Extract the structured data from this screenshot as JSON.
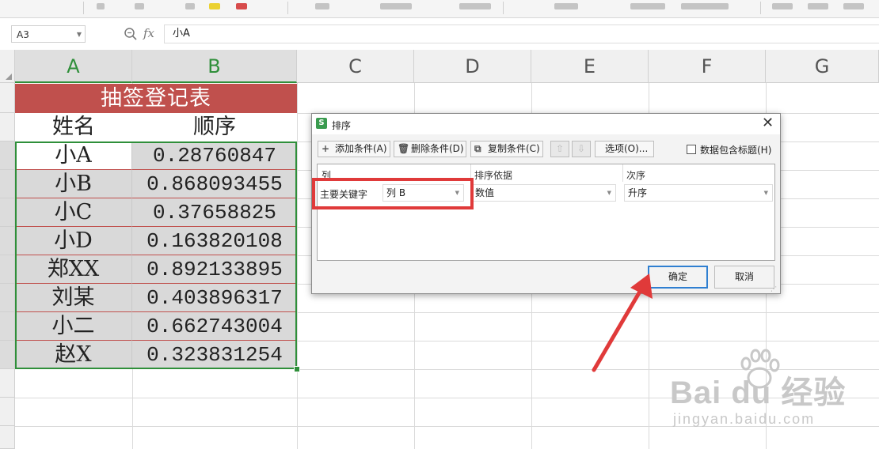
{
  "formula_bar": {
    "name_box": "A3",
    "fx_label": "fx",
    "content": "小A"
  },
  "columns": [
    "A",
    "B",
    "C",
    "D",
    "E",
    "F",
    "G"
  ],
  "table": {
    "title": "抽签登记表",
    "headers": [
      "姓名",
      "顺序"
    ],
    "rows": [
      {
        "name": "小A",
        "value": "0.28760847"
      },
      {
        "name": "小B",
        "value": "0.868093455"
      },
      {
        "name": "小C",
        "value": "0.37658825"
      },
      {
        "name": "小D",
        "value": "0.163820108"
      },
      {
        "name": "郑XX",
        "value": "0.892133895"
      },
      {
        "name": "刘某",
        "value": "0.403896317"
      },
      {
        "name": "小二",
        "value": "0.662743004"
      },
      {
        "name": "赵X",
        "value": "0.323831254"
      }
    ]
  },
  "sort_dialog": {
    "title": "排序",
    "toolbar": {
      "add_condition": "添加条件(A)",
      "delete_condition": "删除条件(D)",
      "copy_condition": "复制条件(C)",
      "options": "选项(O)...",
      "has_header_checkbox": "数据包含标题(H)",
      "has_header_checked": false
    },
    "headers": {
      "column": "列",
      "sort_on": "排序依据",
      "order": "次序"
    },
    "condition": {
      "label": "主要关键字",
      "column": "列 B",
      "sort_on": "数值",
      "order": "升序"
    },
    "ok_label": "确定",
    "cancel_label": "取消"
  },
  "watermark": {
    "main": "Bai du 经验",
    "sub": "jingyan.baidu.com"
  },
  "colors": {
    "title_fill": "#c0504d",
    "selection": "#2f8f3a",
    "highlight": "#e03a3a",
    "ok_border": "#2f7fd1"
  }
}
